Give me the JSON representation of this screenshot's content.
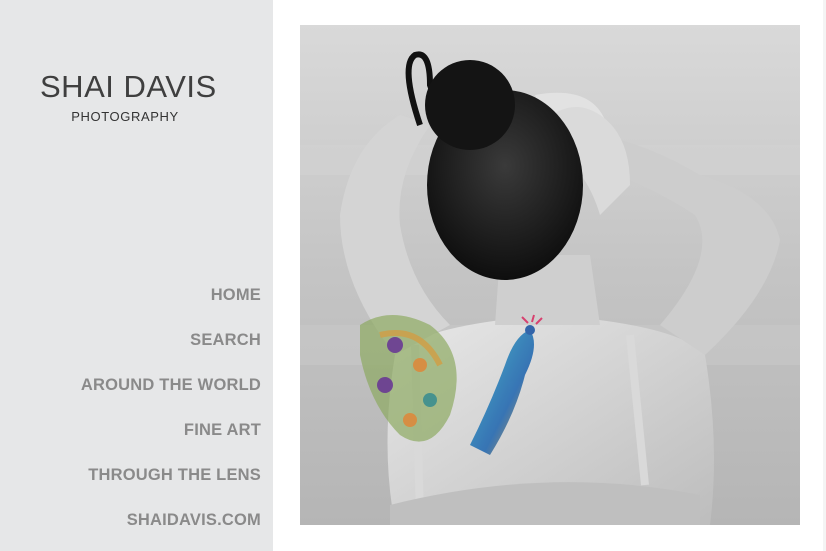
{
  "brand": {
    "title": "SHAI DAVIS",
    "subtitle": "PHOTOGRAPHY"
  },
  "nav": {
    "items": [
      {
        "label": "HOME"
      },
      {
        "label": "SEARCH"
      },
      {
        "label": "AROUND THE WORLD"
      },
      {
        "label": "FINE ART"
      },
      {
        "label": "THROUGH THE LENS"
      },
      {
        "label": "SHAIDAVIS.COM"
      }
    ]
  },
  "colors": {
    "sidebar_bg": "#e6e7e8",
    "nav_text": "#8a8a8a",
    "brand_text": "#3f3f3f"
  }
}
